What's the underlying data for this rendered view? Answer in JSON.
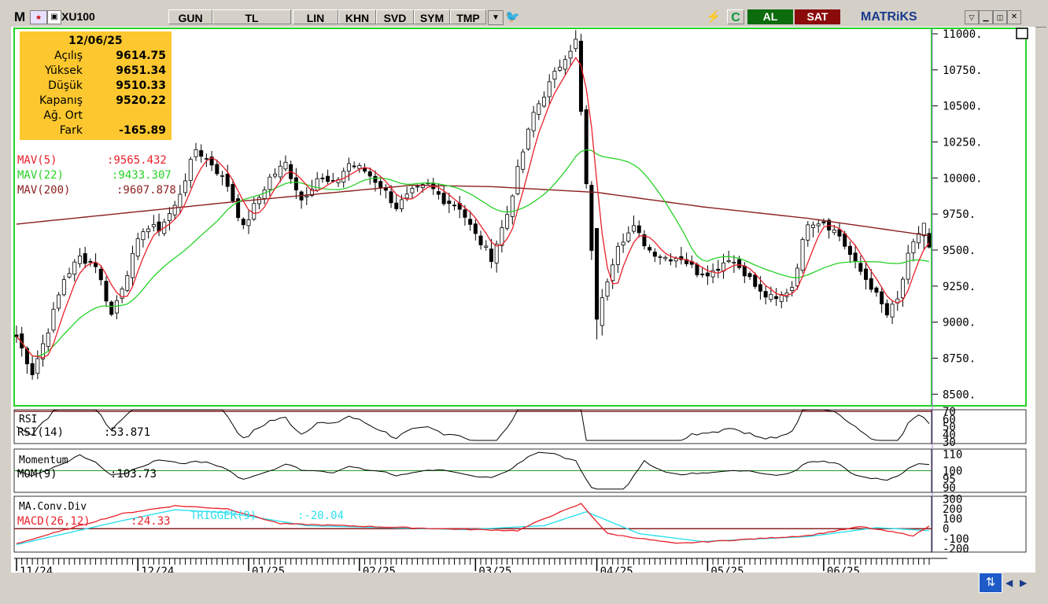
{
  "toolbar": {
    "logo": "M",
    "symbol": "XU100",
    "buttons": [
      "GUN",
      "TL",
      "LIN",
      "KHN",
      "SVD",
      "SYM",
      "TMP"
    ],
    "c_label": "C",
    "buy_label": "AL",
    "sell_label": "SAT",
    "brand": "MATRiKS"
  },
  "info_box": {
    "date": "12/06/25",
    "rows": [
      {
        "label": "Açılış",
        "value": "9614.75"
      },
      {
        "label": "Yüksek",
        "value": "9651.34"
      },
      {
        "label": "Düşük",
        "value": "9510.33"
      },
      {
        "label": "Kapanış",
        "value": "9520.22"
      },
      {
        "label": "Ağ. Ort",
        "value": ""
      },
      {
        "label": "Fark",
        "value": "-165.89"
      }
    ]
  },
  "indicators": {
    "mav5": {
      "label": "MAV(5)",
      "value": ":9565.432",
      "color": "#e8202a"
    },
    "mav22": {
      "label": "MAV(22)",
      "value": ":9433.307",
      "color": "#27d227"
    },
    "mav200": {
      "label": "MAV(200)",
      "value": ":9607.878",
      "color": "#8b1f1f"
    },
    "rsi_title": "RSI",
    "rsi_label": "RSI(14)",
    "rsi_value": ":53.871",
    "mom_title": "Momentum",
    "mom_label": "MOM(9)",
    "mom_value": ":103.73",
    "macd_title": "MA.Conv.Div",
    "macd_label": "MACD(26,12)",
    "macd_value": ":24.33",
    "trigger_label": "TRIGGER(9)",
    "trigger_value": ":-20.04"
  },
  "chart_data": {
    "type": "candlestick",
    "y_ticks": [
      "11000.",
      "10750.",
      "10500.",
      "10250.",
      "10000.",
      "9750.",
      "9500.",
      "9250.",
      "9000.",
      "8750.",
      "8500."
    ],
    "ylim": [
      8500,
      11000
    ],
    "x_labels": [
      "11/24",
      "12/24",
      "01/25",
      "02/25",
      "03/25",
      "04/25",
      "05/25",
      "06/25"
    ],
    "close_anchors": [
      [
        0,
        8900
      ],
      [
        3,
        8650
      ],
      [
        6,
        8950
      ],
      [
        9,
        9300
      ],
      [
        12,
        9450
      ],
      [
        15,
        9400
      ],
      [
        18,
        9050
      ],
      [
        21,
        9350
      ],
      [
        24,
        9650
      ],
      [
        27,
        9650
      ],
      [
        30,
        9800
      ],
      [
        34,
        10200
      ],
      [
        37,
        10100
      ],
      [
        40,
        9950
      ],
      [
        43,
        9650
      ],
      [
        45,
        9800
      ],
      [
        48,
        10000
      ],
      [
        51,
        10100
      ],
      [
        54,
        9850
      ],
      [
        57,
        10000
      ],
      [
        60,
        9950
      ],
      [
        63,
        10100
      ],
      [
        66,
        10050
      ],
      [
        69,
        9950
      ],
      [
        72,
        9800
      ],
      [
        75,
        9900
      ],
      [
        78,
        9950
      ],
      [
        81,
        9850
      ],
      [
        84,
        9800
      ],
      [
        87,
        9600
      ],
      [
        90,
        9450
      ],
      [
        93,
        9750
      ],
      [
        95,
        10050
      ],
      [
        98,
        10450
      ],
      [
        101,
        10650
      ],
      [
        104,
        10850
      ],
      [
        106,
        10950
      ],
      [
        108,
        9950
      ],
      [
        110,
        9000
      ],
      [
        112,
        9300
      ],
      [
        114,
        9550
      ],
      [
        117,
        9650
      ],
      [
        120,
        9500
      ],
      [
        123,
        9450
      ],
      [
        126,
        9450
      ],
      [
        129,
        9350
      ],
      [
        132,
        9350
      ],
      [
        135,
        9450
      ],
      [
        138,
        9350
      ],
      [
        141,
        9200
      ],
      [
        144,
        9150
      ],
      [
        147,
        9250
      ],
      [
        150,
        9700
      ],
      [
        153,
        9700
      ],
      [
        156,
        9600
      ],
      [
        159,
        9400
      ],
      [
        162,
        9250
      ],
      [
        165,
        9050
      ],
      [
        167,
        9150
      ],
      [
        169,
        9450
      ],
      [
        171,
        9620
      ],
      [
        173,
        9520
      ]
    ],
    "ma200_anchors": [
      [
        0,
        9680
      ],
      [
        40,
        9830
      ],
      [
        75,
        9950
      ],
      [
        90,
        9940
      ],
      [
        110,
        9900
      ],
      [
        130,
        9800
      ],
      [
        150,
        9720
      ],
      [
        173,
        9600
      ]
    ],
    "rsi_ticks": [
      "70",
      "60",
      "50",
      "40",
      "30"
    ],
    "mom_ticks": [
      "110",
      "100",
      "95",
      "90"
    ],
    "macd_ticks": [
      "300",
      "200",
      "100",
      "0",
      "-100",
      "-200"
    ],
    "macd_anchors": [
      [
        0,
        -150
      ],
      [
        20,
        150
      ],
      [
        30,
        230
      ],
      [
        40,
        200
      ],
      [
        50,
        50
      ],
      [
        80,
        0
      ],
      [
        95,
        -20
      ],
      [
        100,
        100
      ],
      [
        107,
        250
      ],
      [
        112,
        -50
      ],
      [
        125,
        -150
      ],
      [
        150,
        -70
      ],
      [
        160,
        20
      ],
      [
        170,
        -70
      ],
      [
        173,
        24
      ]
    ],
    "trigger_anchors": [
      [
        0,
        -160
      ],
      [
        20,
        80
      ],
      [
        30,
        190
      ],
      [
        40,
        160
      ],
      [
        55,
        30
      ],
      [
        85,
        -10
      ],
      [
        100,
        30
      ],
      [
        108,
        170
      ],
      [
        118,
        -50
      ],
      [
        130,
        -130
      ],
      [
        150,
        -80
      ],
      [
        163,
        10
      ],
      [
        173,
        -20
      ]
    ]
  }
}
